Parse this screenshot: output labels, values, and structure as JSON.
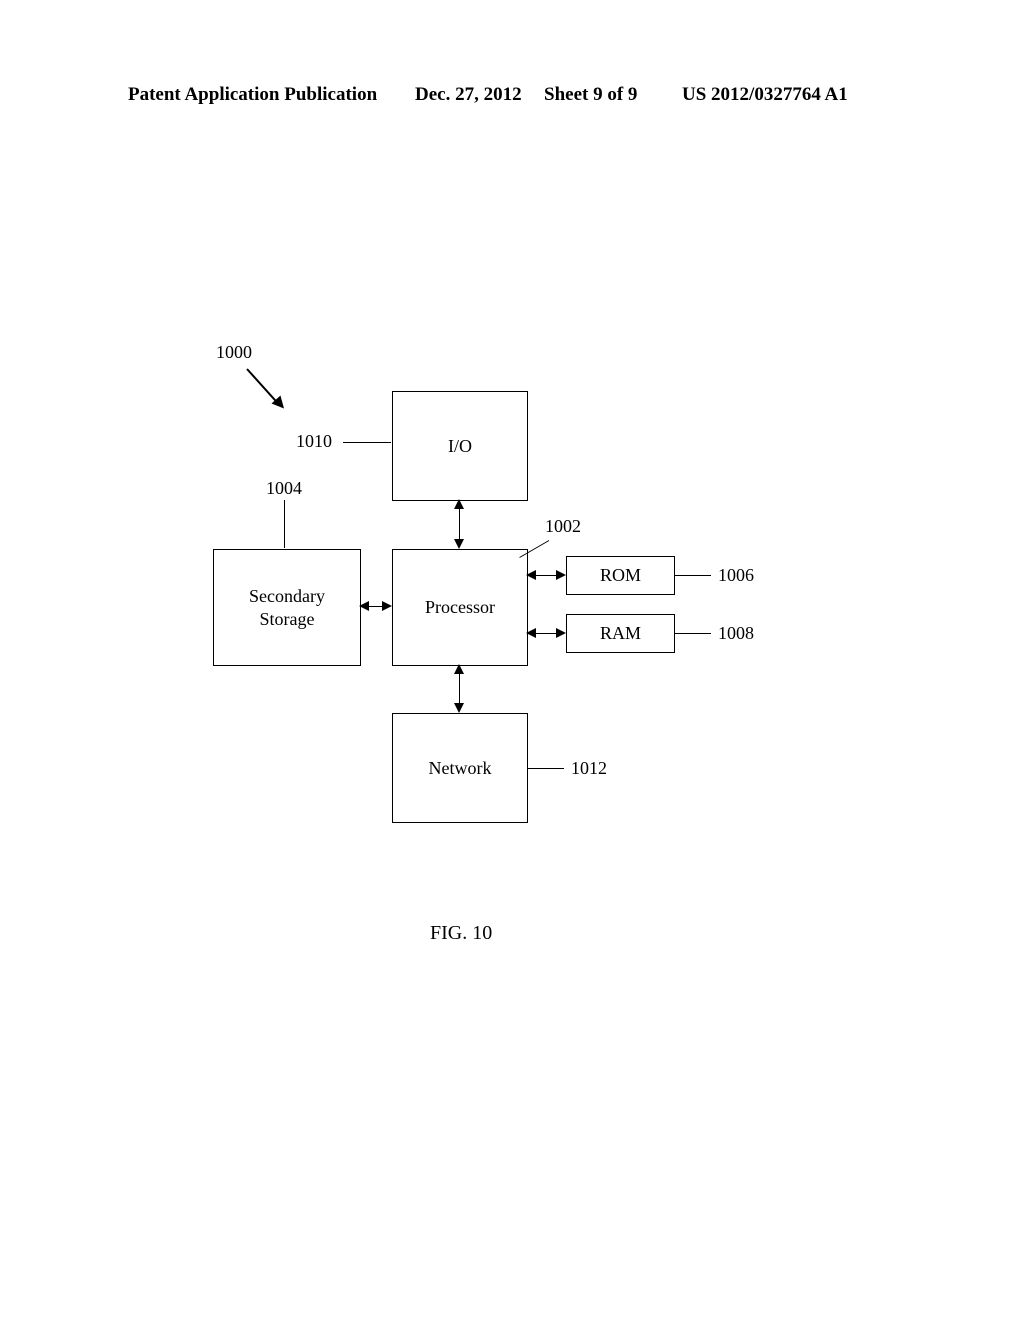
{
  "header": {
    "left": "Patent Application Publication",
    "date": "Dec. 27, 2012",
    "sheet": "Sheet 9 of 9",
    "right": "US 2012/0327764 A1"
  },
  "diagram": {
    "refMain": "1000",
    "io": {
      "label": "I/O",
      "ref": "1010"
    },
    "processor": {
      "label": "Processor",
      "ref": "1002"
    },
    "secondary": {
      "label": "Secondary\nStorage",
      "ref": "1004"
    },
    "rom": {
      "label": "ROM",
      "ref": "1006"
    },
    "ram": {
      "label": "RAM",
      "ref": "1008"
    },
    "network": {
      "label": "Network",
      "ref": "1012"
    }
  },
  "figure": {
    "caption": "FIG. 10"
  }
}
